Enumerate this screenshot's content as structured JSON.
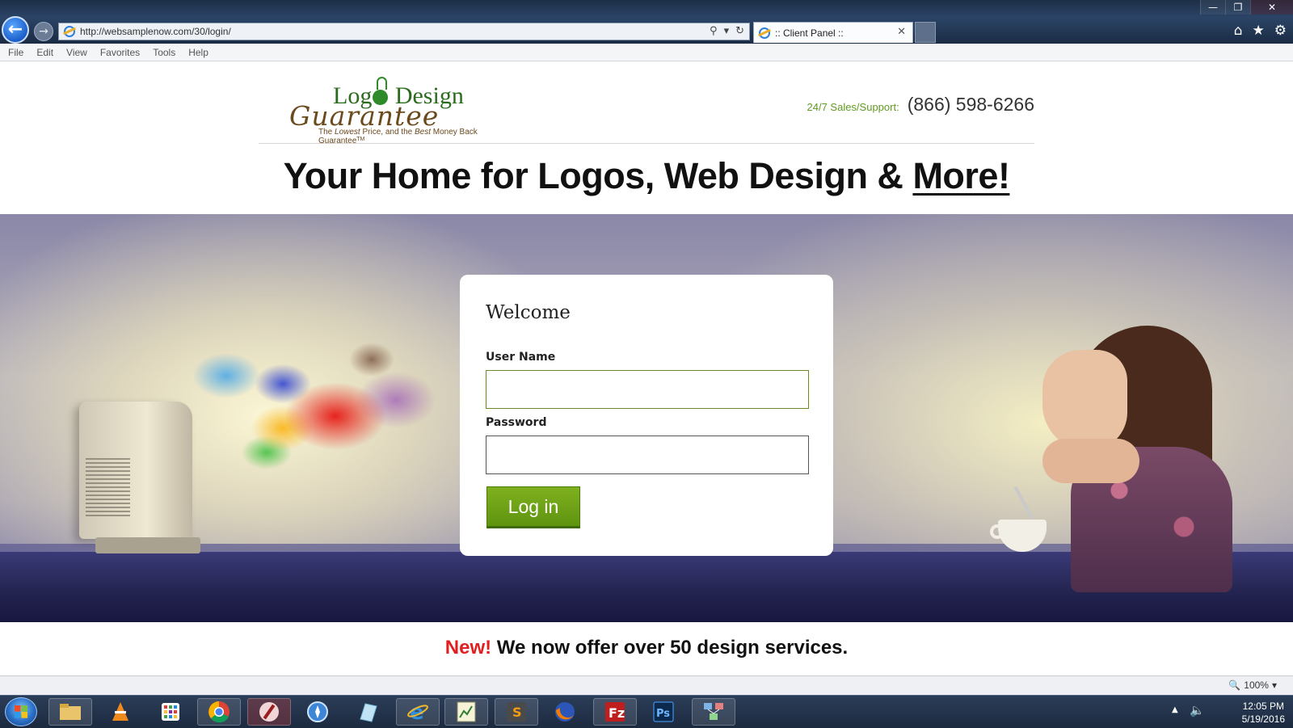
{
  "browser": {
    "url": "http://websamplenow.com/30/login/",
    "tab_title": ":: Client Panel ::",
    "menu": [
      "File",
      "Edit",
      "View",
      "Favorites",
      "Tools",
      "Help"
    ],
    "zoom": "100%"
  },
  "header": {
    "logo": {
      "word_logo": "Log",
      "word_design": "Design",
      "word_guarantee": "Guarantee",
      "tagline_pre": "The ",
      "tagline_lowest": "Lowest",
      "tagline_mid": " Price, and the ",
      "tagline_best": "Best",
      "tagline_post": " Money Back Guarantee",
      "tm": "TM"
    },
    "support_label": "24/7 Sales/Support:",
    "support_phone": "(866) 598-6266"
  },
  "hero": {
    "title_main": "Your Home for Logos, Web Design & ",
    "title_more": "More!"
  },
  "login": {
    "welcome": "Welcome",
    "username_label": "User Name",
    "username_value": "",
    "password_label": "Password",
    "password_value": "",
    "submit_label": "Log in"
  },
  "promo": {
    "new": "New!",
    "text": " We now offer over 50 design services."
  },
  "taskbar": {
    "apps": [
      "file-explorer",
      "vlc",
      "app-grid",
      "chrome",
      "paint-tool",
      "safari",
      "notes-app",
      "internet-explorer",
      "chart-app",
      "sublime",
      "firefox",
      "filezilla",
      "photoshop",
      "network-app"
    ],
    "time": "12:05 PM",
    "date": "5/19/2016"
  },
  "colors": {
    "brand_green": "#6fa41a",
    "new_red": "#e21f1f",
    "support_green": "#5f9a22"
  }
}
